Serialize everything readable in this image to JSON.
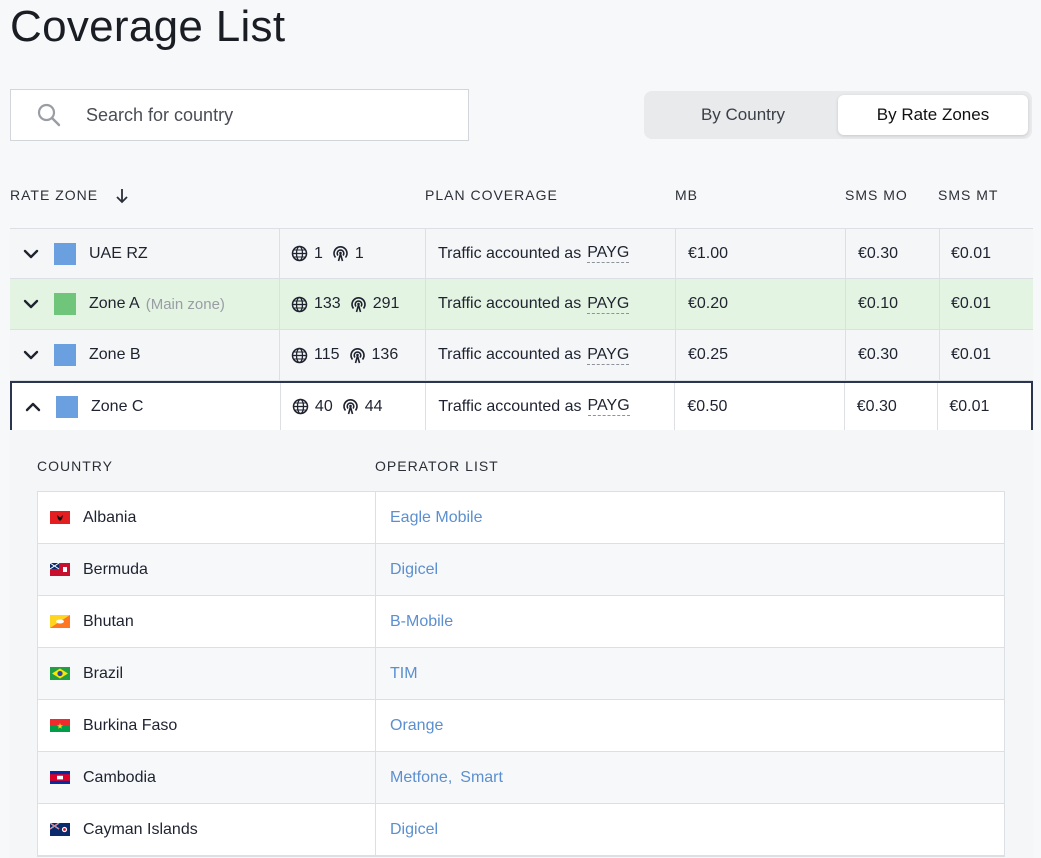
{
  "page": {
    "title": "Coverage List"
  },
  "search": {
    "placeholder": "Search for country"
  },
  "view_toggle": {
    "options": [
      "By Country",
      "By Rate Zones"
    ],
    "active": "By Rate Zones"
  },
  "columns": {
    "rate_zone": "RATE ZONE",
    "plan_coverage": "PLAN COVERAGE",
    "mb": "MB",
    "sms_mo": "SMS MO",
    "sms_mt": "SMS MT"
  },
  "zones": [
    {
      "name": "UAE RZ",
      "note": "",
      "countries": "1",
      "operators": "1",
      "plan_text": "Traffic accounted as",
      "plan_type": "PAYG",
      "mb": "€1.00",
      "sms_mo": "€0.30",
      "sms_mt": "€0.01",
      "color": "#6a9fe0",
      "state": "collapsed"
    },
    {
      "name": "Zone A",
      "note": "(Main zone)",
      "countries": "133",
      "operators": "291",
      "plan_text": "Traffic accounted as",
      "plan_type": "PAYG",
      "mb": "€0.20",
      "sms_mo": "€0.10",
      "sms_mt": "€0.01",
      "color": "#6fc67a",
      "state": "collapsed"
    },
    {
      "name": "Zone B",
      "note": "",
      "countries": "115",
      "operators": "136",
      "plan_text": "Traffic accounted as",
      "plan_type": "PAYG",
      "mb": "€0.25",
      "sms_mo": "€0.30",
      "sms_mt": "€0.01",
      "color": "#6a9fe0",
      "state": "collapsed"
    },
    {
      "name": "Zone C",
      "note": "",
      "countries": "40",
      "operators": "44",
      "plan_text": "Traffic accounted as",
      "plan_type": "PAYG",
      "mb": "€0.50",
      "sms_mo": "€0.30",
      "sms_mt": "€0.01",
      "color": "#6a9fe0",
      "state": "expanded"
    }
  ],
  "expanded_zone": {
    "columns": {
      "country": "COUNTRY",
      "operator_list": "OPERATOR LIST"
    },
    "countries": [
      {
        "name": "Albania",
        "flag": "flag-albania",
        "operators": [
          "Eagle Mobile"
        ]
      },
      {
        "name": "Bermuda",
        "flag": "flag-bermuda",
        "operators": [
          "Digicel"
        ]
      },
      {
        "name": "Bhutan",
        "flag": "flag-bhutan",
        "operators": [
          "B-Mobile"
        ]
      },
      {
        "name": "Brazil",
        "flag": "flag-brazil",
        "operators": [
          "TIM"
        ]
      },
      {
        "name": "Burkina Faso",
        "flag": "flag-burkina-faso",
        "operators": [
          "Orange"
        ]
      },
      {
        "name": "Cambodia",
        "flag": "flag-cambodia",
        "operators": [
          "Metfone,",
          "Smart"
        ]
      },
      {
        "name": "Cayman Islands",
        "flag": "flag-cayman-islands",
        "operators": [
          "Digicel"
        ]
      }
    ]
  },
  "colors": {
    "accent_link": "#5b8fd0",
    "main_zone_bg": "#e3f4e3",
    "selected_border": "#2c3550"
  }
}
